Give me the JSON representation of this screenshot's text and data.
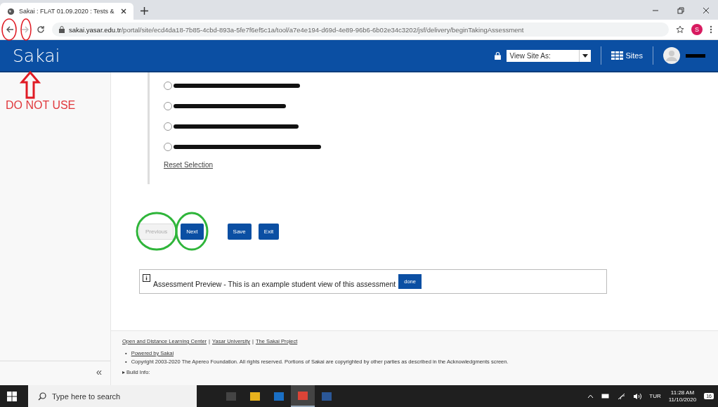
{
  "browser": {
    "tab_title": "Sakai : FLAT 01.09.2020 : Tests &",
    "url_host": "sakai.yasar.edu.tr",
    "url_path": "/portal/site/ecd4da18-7b85-4cbd-893a-5fe7f6ef5c1a/tool/a7e4e194-d69d-4e89-96b6-6b02e34c3202/jsf/delivery/beginTakingAssessment",
    "profile_initial": "S"
  },
  "header": {
    "logo": "Sakai",
    "view_site_as": "View Site As:",
    "sites": "Sites"
  },
  "annotation": {
    "warning": "DO NOT USE"
  },
  "sidebar": {
    "collapse": "«"
  },
  "question": {
    "options": [
      {
        "selected": false
      },
      {
        "selected": false
      },
      {
        "selected": false
      },
      {
        "selected": false
      }
    ],
    "reset": "Reset Selection"
  },
  "buttons": [
    {
      "label": "Previous",
      "disabled": true
    },
    {
      "label": "Next",
      "disabled": false
    },
    {
      "label": "Save",
      "disabled": false
    },
    {
      "label": "Exit",
      "disabled": false
    }
  ],
  "preview": {
    "text": "Assessment Preview - This is an example student view of this assessment",
    "button": "done"
  },
  "footer": {
    "links": [
      "Open and Distance Learning Center",
      "Yasar University",
      "The Sakai Project"
    ],
    "separator": "|",
    "items": [
      {
        "kind": "link",
        "bullet": "•",
        "text": "Powered by Sakai"
      },
      {
        "kind": "text",
        "bullet": "•",
        "text": "Copyright 2003-2020 The Apereo Foundation. All rights reserved. Portions of Sakai are copyrighted by other parties as described in the Acknowledgments screen."
      }
    ],
    "build_marker": "▸",
    "build_info": "Build Info:"
  },
  "taskbar": {
    "search_placeholder": "Type here to search",
    "apps": [
      {
        "selected": false
      },
      {
        "selected": false
      },
      {
        "selected": false
      },
      {
        "selected": true
      },
      {
        "selected": false
      }
    ],
    "language": "TUR",
    "time": "11:28 AM",
    "date": "11/10/2020",
    "notifications": "16"
  }
}
